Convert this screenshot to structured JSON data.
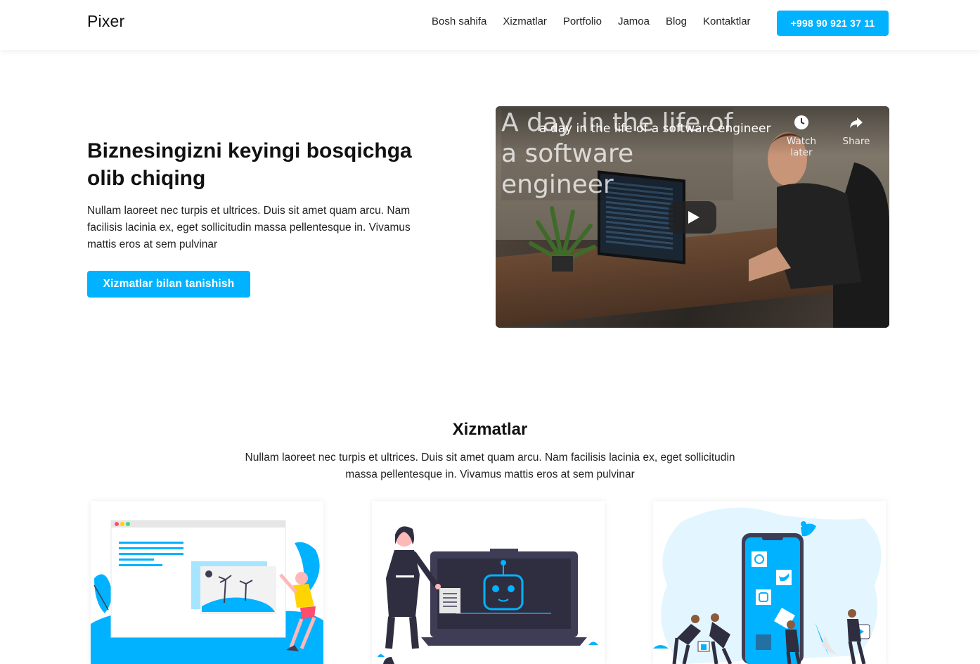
{
  "header": {
    "logo": "Pixer",
    "nav": [
      "Bosh sahifa",
      "Xizmatlar",
      "Portfolio",
      "Jamoa",
      "Blog",
      "Kontaktlar"
    ],
    "phone": "+998 90 921 37 11"
  },
  "hero": {
    "title": "Biznesingizni keyingi bosqichga olib chiqing",
    "text": "Nullam laoreet nec turpis et ultrices. Duis sit amet quam arcu. Nam facilisis lacinia ex, eget sollicitudin massa pellentesque in. Vivamus mattis eros at sem pulvinar",
    "button": "Xizmatlar bilan tanishish"
  },
  "video": {
    "overlay_text": "A day in the life of a software engineer",
    "title": "a day in the life of a software engineer",
    "watch_later": "Watch later",
    "share": "Share"
  },
  "services": {
    "title": "Xizmatlar",
    "text": "Nullam laoreet nec turpis et ultrices. Duis sit amet quam arcu. Nam facilisis lacinia ex, eget sollicitudin massa pellentesque in. Vivamus mattis eros at sem pulvinar"
  },
  "colors": {
    "accent": "#00b2ff",
    "illustration_dark": "#3f3d56",
    "illustration_light_blue": "#e3f6ff"
  }
}
